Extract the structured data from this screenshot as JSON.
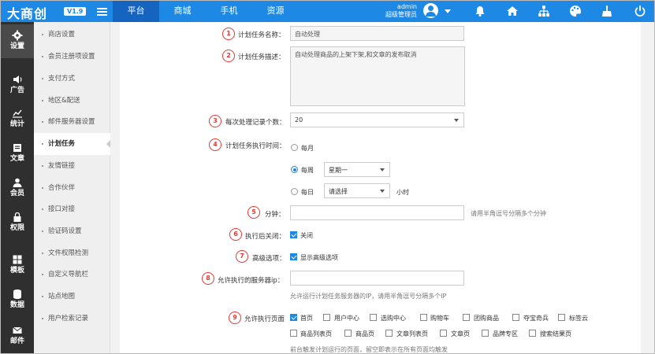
{
  "app": {
    "logo": "大商创",
    "version": "V1.9"
  },
  "topnav": {
    "tabs": [
      "平台",
      "商城",
      "手机",
      "资源"
    ],
    "active": 0
  },
  "user": {
    "name": "admin",
    "role": "超级管理员"
  },
  "iconbar": [
    {
      "label": "设置",
      "icon": "gear-icon"
    },
    {
      "label": "广告",
      "icon": "speaker-icon"
    },
    {
      "label": "统计",
      "icon": "chart-icon"
    },
    {
      "label": "文章",
      "icon": "book-icon"
    },
    {
      "label": "会员",
      "icon": "user-icon"
    },
    {
      "label": "权限",
      "icon": "lock-icon"
    },
    {
      "label": "模板",
      "icon": "grid-icon"
    },
    {
      "label": "数据",
      "icon": "database-icon"
    },
    {
      "label": "邮件",
      "icon": "mail-icon"
    }
  ],
  "submenu": [
    "商店设置",
    "会员注册项设置",
    "支付方式",
    "地区&配送",
    "邮件服务器设置",
    "计划任务",
    "友情链接",
    "合作伙伴",
    "接口对接",
    "验证码设置",
    "文件权限检测",
    "自定义导航栏",
    "站点地图",
    "用户检索记录"
  ],
  "submenu_active": 5,
  "form": {
    "name": {
      "num": "1",
      "label": "计划任务名称：",
      "value": "自动处理"
    },
    "desc": {
      "num": "2",
      "label": "计划任务描述：",
      "value": "自动处理商品的上架下架,和文章的发布取消"
    },
    "count": {
      "num": "3",
      "label": "每次处理记录个数：",
      "value": "20"
    },
    "time": {
      "num": "4",
      "label": "计划任务执行时间：",
      "monthly": "每月",
      "weekly": "每周",
      "weekly_value": "星期一",
      "daily": "每日",
      "daily_value": "请选择",
      "hour_unit": "小时"
    },
    "minute": {
      "num": "5",
      "label": "分钟：",
      "value": "",
      "hint": "请用半角逗号分隔多个分钟"
    },
    "close_after": {
      "num": "6",
      "label": "执行后关闭：",
      "option": "关闭"
    },
    "advanced": {
      "num": "7",
      "label": "高级选项：",
      "option": "显示高级选项"
    },
    "server_ip": {
      "num": "8",
      "label": "允许执行的服务器ip：",
      "value": "",
      "hint": "允许运行计划任务服务器的IP，请用半角逗号分隔多个IP"
    },
    "pages": {
      "num": "9",
      "label": "允许执行页面",
      "row1": [
        "首页",
        "用户中心",
        "选购中心",
        "购物车",
        "团购商品",
        "夺宝奇兵",
        "标签云"
      ],
      "row2": [
        "商品列表页",
        "商品页",
        "文章列表页",
        "文章页",
        "品牌专区",
        "搜索结果页"
      ],
      "hint": "前台触发计划运行的页面，留空即表示在所有页面均触发"
    }
  }
}
